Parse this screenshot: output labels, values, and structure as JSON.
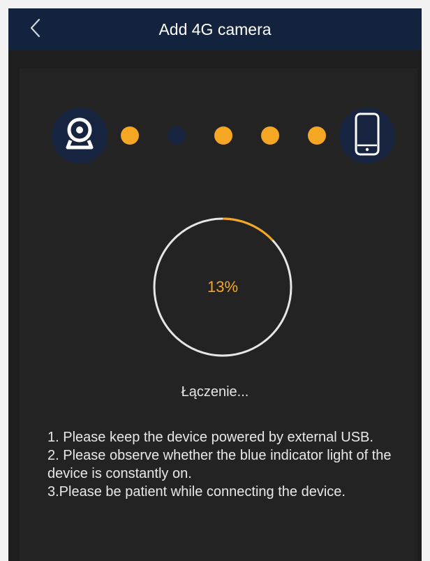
{
  "header": {
    "title": "Add 4G camera",
    "back_icon": "chevron-left-icon"
  },
  "steps": {
    "start_icon": "webcam-icon",
    "end_icon": "smartphone-icon",
    "dots": [
      {
        "state": "active",
        "color": "#f5a623"
      },
      {
        "state": "pending",
        "color": "#16243f"
      },
      {
        "state": "active",
        "color": "#f5a623"
      },
      {
        "state": "active",
        "color": "#f5a623"
      },
      {
        "state": "active",
        "color": "#f5a623"
      }
    ]
  },
  "progress": {
    "value": 0.13,
    "label": "13%",
    "accent": "#f5a623",
    "track": "#e6e6e6"
  },
  "status_text": "Łączenie...",
  "instructions": [
    "1. Please keep the device powered by external USB.",
    "2. Please observe whether the blue indicator light of the device is constantly on.",
    "3.Please be patient while connecting the device."
  ],
  "colors": {
    "header_bg": "#14233d",
    "screen_bg": "#1e1e1f",
    "accent": "#f5a623"
  }
}
